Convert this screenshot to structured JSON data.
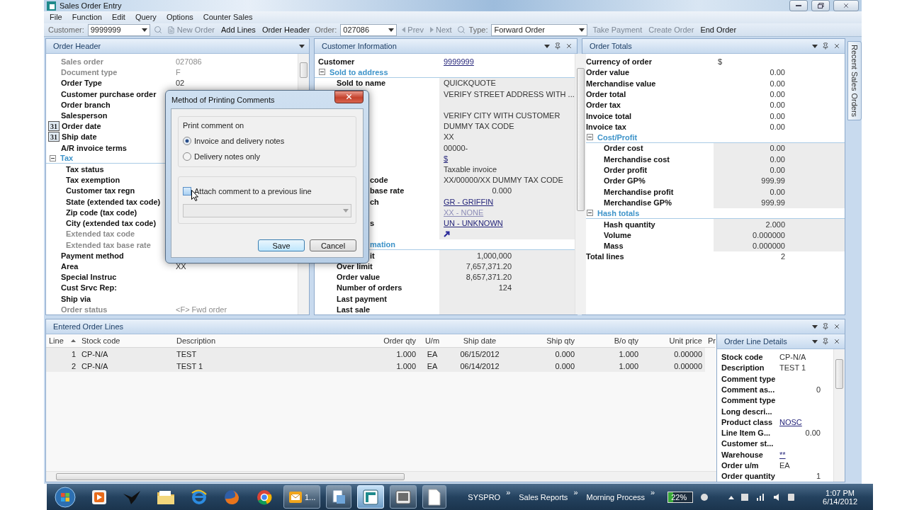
{
  "window": {
    "title": "Sales Order Entry"
  },
  "menu": [
    "File",
    "Function",
    "Edit",
    "Query",
    "Options",
    "Counter Sales"
  ],
  "toolbar": [
    {
      "kind": "field",
      "label": "Customer:",
      "value": "9999999"
    },
    {
      "kind": "search"
    },
    {
      "kind": "new",
      "label": "New Order",
      "disabled": true
    },
    {
      "kind": "button",
      "label": "Add Lines",
      "disabled": false
    },
    {
      "kind": "button",
      "label": "Order Header",
      "disabled": false
    },
    {
      "kind": "field",
      "label": "Order:",
      "value": "027086"
    },
    {
      "kind": "prev",
      "label": "Prev",
      "disabled": true
    },
    {
      "kind": "next",
      "label": "Next",
      "disabled": true
    },
    {
      "kind": "search"
    },
    {
      "kind": "field",
      "label": "Type:",
      "value": "Forward Order"
    },
    {
      "kind": "button",
      "label": "Take Payment",
      "disabled": true
    },
    {
      "kind": "button",
      "label": "Create Order",
      "disabled": true
    },
    {
      "kind": "button",
      "label": "End Order",
      "disabled": false
    }
  ],
  "order_header": {
    "title": "Order Header",
    "rows": [
      {
        "label": "Sales order",
        "value": "027086",
        "disabled": true
      },
      {
        "label": "Document type",
        "value": "F",
        "disabled": true
      },
      {
        "label": "Order Type",
        "value": "02"
      },
      {
        "label": "Customer purchase order"
      },
      {
        "label": "Order branch"
      },
      {
        "label": "Salesperson"
      },
      {
        "kind": "date",
        "badge": "31",
        "label": "Order date"
      },
      {
        "kind": "date",
        "badge": "31",
        "label": "Ship date"
      },
      {
        "label": "A/R invoice terms"
      },
      {
        "kind": "section",
        "label": "Tax",
        "expanded": true,
        "children": [
          {
            "label": "Tax status"
          },
          {
            "label": "Tax exemption"
          },
          {
            "label": "Customer tax regn"
          },
          {
            "label": "State (extended tax code)"
          },
          {
            "label": "Zip code (tax code)"
          },
          {
            "label": "City (extended tax code)"
          },
          {
            "label": "Extended tax code",
            "disabled": true
          },
          {
            "label": "Extended tax base rate",
            "disabled": true
          }
        ]
      },
      {
        "label": "Payment method"
      },
      {
        "label": "Area",
        "value": "XX"
      },
      {
        "label": "Special Instruc"
      },
      {
        "label": "Cust Srvc Rep:"
      },
      {
        "label": "Ship via"
      },
      {
        "label": "Order status",
        "value": "<F> Fwd order",
        "disabled": true
      }
    ]
  },
  "customer_information": {
    "title": "Customer Information",
    "rows": [
      {
        "label": "Customer",
        "value": "9999999",
        "kind": "link"
      },
      {
        "kind": "section",
        "label": "Sold to address",
        "expanded": true,
        "children": [
          {
            "label": "Sold to name",
            "value": "QUICKQUOTE"
          },
          {
            "value": "VERIFY STREET ADDRESS WITH ..."
          },
          {
            "kind": "blank"
          },
          {
            "value": "VERIFY CITY WITH CUSTOMER"
          },
          {
            "value": "DUMMY TAX CODE"
          },
          {
            "value": "XX"
          },
          {
            "value": "00000-"
          },
          {
            "value": "$",
            "kind": "link"
          },
          {
            "value": "Taxable invoice"
          },
          {
            "label": "code",
            "covered": true,
            "value": "XX/00000/XX  DUMMY TAX CODE"
          },
          {
            "label": "base rate",
            "covered": true,
            "value": "0.000",
            "kind": "number"
          },
          {
            "label": "ch",
            "covered": true,
            "value": "GR - GRIFFIN",
            "kind": "link"
          },
          {
            "value": "XX - NONE",
            "kind": "link",
            "disabled": true
          },
          {
            "label": "s",
            "covered": true,
            "value": "UN - UNKNOWN",
            "kind": "link"
          },
          {
            "kind": "arrow"
          }
        ]
      },
      {
        "kind": "section",
        "label": "mation",
        "covered": true,
        "expanded": true,
        "children": [
          {
            "label": "it",
            "covered": true,
            "value": "1,000,000",
            "kind": "number"
          },
          {
            "label": "Over limit",
            "value": "7,657,371.20",
            "kind": "number"
          },
          {
            "label": "Order value",
            "value": "8,657,371.20",
            "kind": "number"
          },
          {
            "label": "Number of orders",
            "value": "124",
            "kind": "number"
          },
          {
            "label": "Last payment"
          },
          {
            "label": "Last sale"
          }
        ]
      }
    ]
  },
  "order_totals": {
    "title": "Order Totals",
    "rows": [
      {
        "label": "Currency of order",
        "value": "$"
      },
      {
        "label": "Order value",
        "value": "0.00",
        "kind": "number"
      },
      {
        "label": "Merchandise value",
        "value": "0.00",
        "kind": "number"
      },
      {
        "label": "Order total",
        "value": "0.00",
        "kind": "number"
      },
      {
        "label": "Order tax",
        "value": "0.00",
        "kind": "number"
      },
      {
        "label": "Invoice total",
        "value": "0.00",
        "kind": "number"
      },
      {
        "label": "Invoice tax",
        "value": "0.00",
        "kind": "number"
      },
      {
        "kind": "section",
        "label": "Cost/Profit",
        "expanded": true,
        "children": [
          {
            "label": "Order cost",
            "value": "0.00",
            "kind": "number"
          },
          {
            "label": "Merchandise cost",
            "value": "0.00",
            "kind": "number"
          },
          {
            "label": "Order profit",
            "value": "0.00",
            "kind": "number"
          },
          {
            "label": "Order GP%",
            "value": "999.99",
            "kind": "number"
          },
          {
            "label": "Merchandise profit",
            "value": "0.00",
            "kind": "number"
          },
          {
            "label": "Merchandise GP%",
            "value": "999.99",
            "kind": "number"
          }
        ]
      },
      {
        "kind": "section",
        "label": "Hash totals",
        "expanded": true,
        "children": [
          {
            "label": "Hash quantity",
            "value": "2.000",
            "kind": "number"
          },
          {
            "label": "Volume",
            "value": "0.000000",
            "kind": "number"
          },
          {
            "label": "Mass",
            "value": "0.000000",
            "kind": "number"
          }
        ]
      },
      {
        "label": "Total lines",
        "value": "2",
        "kind": "number"
      }
    ]
  },
  "side_tabs": [
    "Recent Sales Orders"
  ],
  "order_lines": {
    "title": "Entered Order Lines",
    "columns": [
      "Line",
      "Stock code",
      "Description",
      "Order qty",
      "U/m",
      "Ship date",
      "Ship qty",
      "B/o qty",
      "Unit price",
      "Pr"
    ],
    "rows": [
      [
        "1",
        "CP-N/A",
        "TEST",
        "1.000",
        "EA",
        "06/15/2012",
        "0.000",
        "1.000",
        "0.00000"
      ],
      [
        "2",
        "CP-N/A",
        "TEST 1",
        "1.000",
        "EA",
        "06/14/2012",
        "0.000",
        "1.000",
        "0.00000"
      ]
    ]
  },
  "order_line_details": {
    "title": "Order Line Details",
    "rows": [
      {
        "label": "Stock code",
        "value": "CP-N/A"
      },
      {
        "label": "Description",
        "value": "TEST 1"
      },
      {
        "label": "Comment type"
      },
      {
        "label": "Comment as...",
        "value": "0",
        "kind": "number"
      },
      {
        "label": "Comment type"
      },
      {
        "label": "Long descri..."
      },
      {
        "label": "Product class",
        "value": "NOSC",
        "kind": "link"
      },
      {
        "label": "Line Item G...",
        "value": "0.00",
        "kind": "number"
      },
      {
        "label": "Customer st..."
      },
      {
        "label": "Warehouse",
        "value": "**",
        "kind": "link"
      },
      {
        "label": "Order u/m",
        "value": "EA"
      },
      {
        "label": "Order quantity",
        "value": "1",
        "kind": "number"
      }
    ]
  },
  "dialog": {
    "title": "Method of Printing Comments",
    "group": "Print comment on",
    "options": [
      {
        "label": "Invoice and delivery notes",
        "selected": true
      },
      {
        "label": "Delivery notes only",
        "selected": false
      }
    ],
    "attach": {
      "label": "Attach comment to a previous line",
      "checked": false
    },
    "dropdown": {
      "disabled": true
    },
    "buttons": [
      {
        "label": "Save",
        "default": true
      },
      {
        "label": "Cancel",
        "default": false
      }
    ]
  },
  "taskbar": {
    "apps": [
      {
        "kind": "start",
        "running": false
      },
      {
        "kind": "media",
        "running": false
      },
      {
        "kind": "bird",
        "running": false
      },
      {
        "kind": "folder",
        "running": false
      },
      {
        "kind": "ie",
        "running": false
      },
      {
        "kind": "firefox",
        "running": false
      },
      {
        "kind": "chrome",
        "running": false
      },
      {
        "kind": "outlook",
        "label": "1...",
        "running": true,
        "selected": false
      },
      {
        "kind": "document",
        "running": true,
        "selected": false
      },
      {
        "kind": "syspro",
        "running": true,
        "selected": true
      },
      {
        "kind": "video",
        "running": true,
        "selected": false
      },
      {
        "kind": "page",
        "running": true,
        "selected": false
      }
    ],
    "toolbars": [
      {
        "label": "SYSPRO",
        "more": "»"
      },
      {
        "label": "Sales Reports",
        "more": "»"
      },
      {
        "label": "Morning Process",
        "more": "»"
      }
    ],
    "battery": "22%",
    "time": "1:07 PM",
    "date": "6/14/2012"
  }
}
